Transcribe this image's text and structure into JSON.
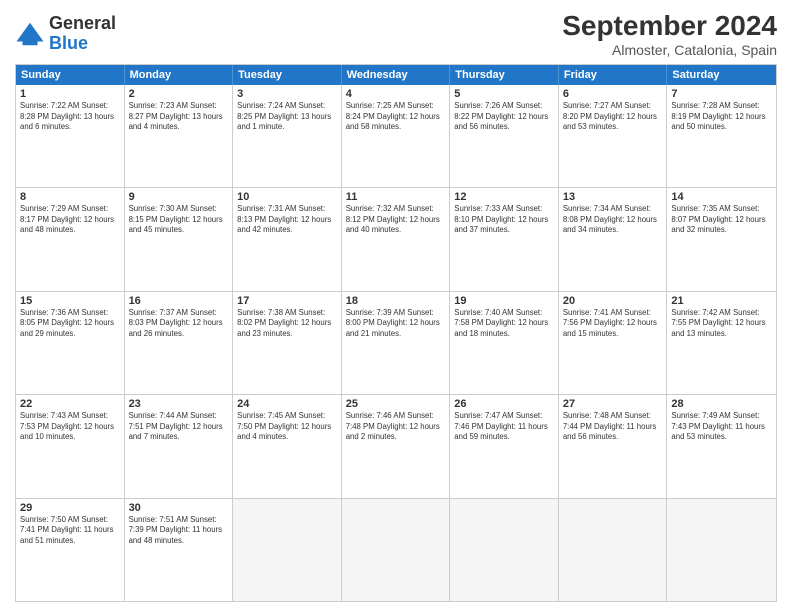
{
  "header": {
    "logo_line1": "General",
    "logo_line2": "Blue",
    "month_title": "September 2024",
    "location": "Almoster, Catalonia, Spain"
  },
  "weekdays": [
    "Sunday",
    "Monday",
    "Tuesday",
    "Wednesday",
    "Thursday",
    "Friday",
    "Saturday"
  ],
  "rows": [
    [
      {
        "day": "",
        "info": ""
      },
      {
        "day": "2",
        "info": "Sunrise: 7:23 AM\nSunset: 8:27 PM\nDaylight: 13 hours\nand 4 minutes."
      },
      {
        "day": "3",
        "info": "Sunrise: 7:24 AM\nSunset: 8:25 PM\nDaylight: 13 hours\nand 1 minute."
      },
      {
        "day": "4",
        "info": "Sunrise: 7:25 AM\nSunset: 8:24 PM\nDaylight: 12 hours\nand 58 minutes."
      },
      {
        "day": "5",
        "info": "Sunrise: 7:26 AM\nSunset: 8:22 PM\nDaylight: 12 hours\nand 56 minutes."
      },
      {
        "day": "6",
        "info": "Sunrise: 7:27 AM\nSunset: 8:20 PM\nDaylight: 12 hours\nand 53 minutes."
      },
      {
        "day": "7",
        "info": "Sunrise: 7:28 AM\nSunset: 8:19 PM\nDaylight: 12 hours\nand 50 minutes."
      }
    ],
    [
      {
        "day": "8",
        "info": "Sunrise: 7:29 AM\nSunset: 8:17 PM\nDaylight: 12 hours\nand 48 minutes."
      },
      {
        "day": "9",
        "info": "Sunrise: 7:30 AM\nSunset: 8:15 PM\nDaylight: 12 hours\nand 45 minutes."
      },
      {
        "day": "10",
        "info": "Sunrise: 7:31 AM\nSunset: 8:13 PM\nDaylight: 12 hours\nand 42 minutes."
      },
      {
        "day": "11",
        "info": "Sunrise: 7:32 AM\nSunset: 8:12 PM\nDaylight: 12 hours\nand 40 minutes."
      },
      {
        "day": "12",
        "info": "Sunrise: 7:33 AM\nSunset: 8:10 PM\nDaylight: 12 hours\nand 37 minutes."
      },
      {
        "day": "13",
        "info": "Sunrise: 7:34 AM\nSunset: 8:08 PM\nDaylight: 12 hours\nand 34 minutes."
      },
      {
        "day": "14",
        "info": "Sunrise: 7:35 AM\nSunset: 8:07 PM\nDaylight: 12 hours\nand 32 minutes."
      }
    ],
    [
      {
        "day": "15",
        "info": "Sunrise: 7:36 AM\nSunset: 8:05 PM\nDaylight: 12 hours\nand 29 minutes."
      },
      {
        "day": "16",
        "info": "Sunrise: 7:37 AM\nSunset: 8:03 PM\nDaylight: 12 hours\nand 26 minutes."
      },
      {
        "day": "17",
        "info": "Sunrise: 7:38 AM\nSunset: 8:02 PM\nDaylight: 12 hours\nand 23 minutes."
      },
      {
        "day": "18",
        "info": "Sunrise: 7:39 AM\nSunset: 8:00 PM\nDaylight: 12 hours\nand 21 minutes."
      },
      {
        "day": "19",
        "info": "Sunrise: 7:40 AM\nSunset: 7:58 PM\nDaylight: 12 hours\nand 18 minutes."
      },
      {
        "day": "20",
        "info": "Sunrise: 7:41 AM\nSunset: 7:56 PM\nDaylight: 12 hours\nand 15 minutes."
      },
      {
        "day": "21",
        "info": "Sunrise: 7:42 AM\nSunset: 7:55 PM\nDaylight: 12 hours\nand 13 minutes."
      }
    ],
    [
      {
        "day": "22",
        "info": "Sunrise: 7:43 AM\nSunset: 7:53 PM\nDaylight: 12 hours\nand 10 minutes."
      },
      {
        "day": "23",
        "info": "Sunrise: 7:44 AM\nSunset: 7:51 PM\nDaylight: 12 hours\nand 7 minutes."
      },
      {
        "day": "24",
        "info": "Sunrise: 7:45 AM\nSunset: 7:50 PM\nDaylight: 12 hours\nand 4 minutes."
      },
      {
        "day": "25",
        "info": "Sunrise: 7:46 AM\nSunset: 7:48 PM\nDaylight: 12 hours\nand 2 minutes."
      },
      {
        "day": "26",
        "info": "Sunrise: 7:47 AM\nSunset: 7:46 PM\nDaylight: 11 hours\nand 59 minutes."
      },
      {
        "day": "27",
        "info": "Sunrise: 7:48 AM\nSunset: 7:44 PM\nDaylight: 11 hours\nand 56 minutes."
      },
      {
        "day": "28",
        "info": "Sunrise: 7:49 AM\nSunset: 7:43 PM\nDaylight: 11 hours\nand 53 minutes."
      }
    ],
    [
      {
        "day": "29",
        "info": "Sunrise: 7:50 AM\nSunset: 7:41 PM\nDaylight: 11 hours\nand 51 minutes."
      },
      {
        "day": "30",
        "info": "Sunrise: 7:51 AM\nSunset: 7:39 PM\nDaylight: 11 hours\nand 48 minutes."
      },
      {
        "day": "",
        "info": ""
      },
      {
        "day": "",
        "info": ""
      },
      {
        "day": "",
        "info": ""
      },
      {
        "day": "",
        "info": ""
      },
      {
        "day": "",
        "info": ""
      }
    ]
  ],
  "row0_day1": {
    "day": "1",
    "info": "Sunrise: 7:22 AM\nSunset: 8:28 PM\nDaylight: 13 hours\nand 6 minutes."
  }
}
